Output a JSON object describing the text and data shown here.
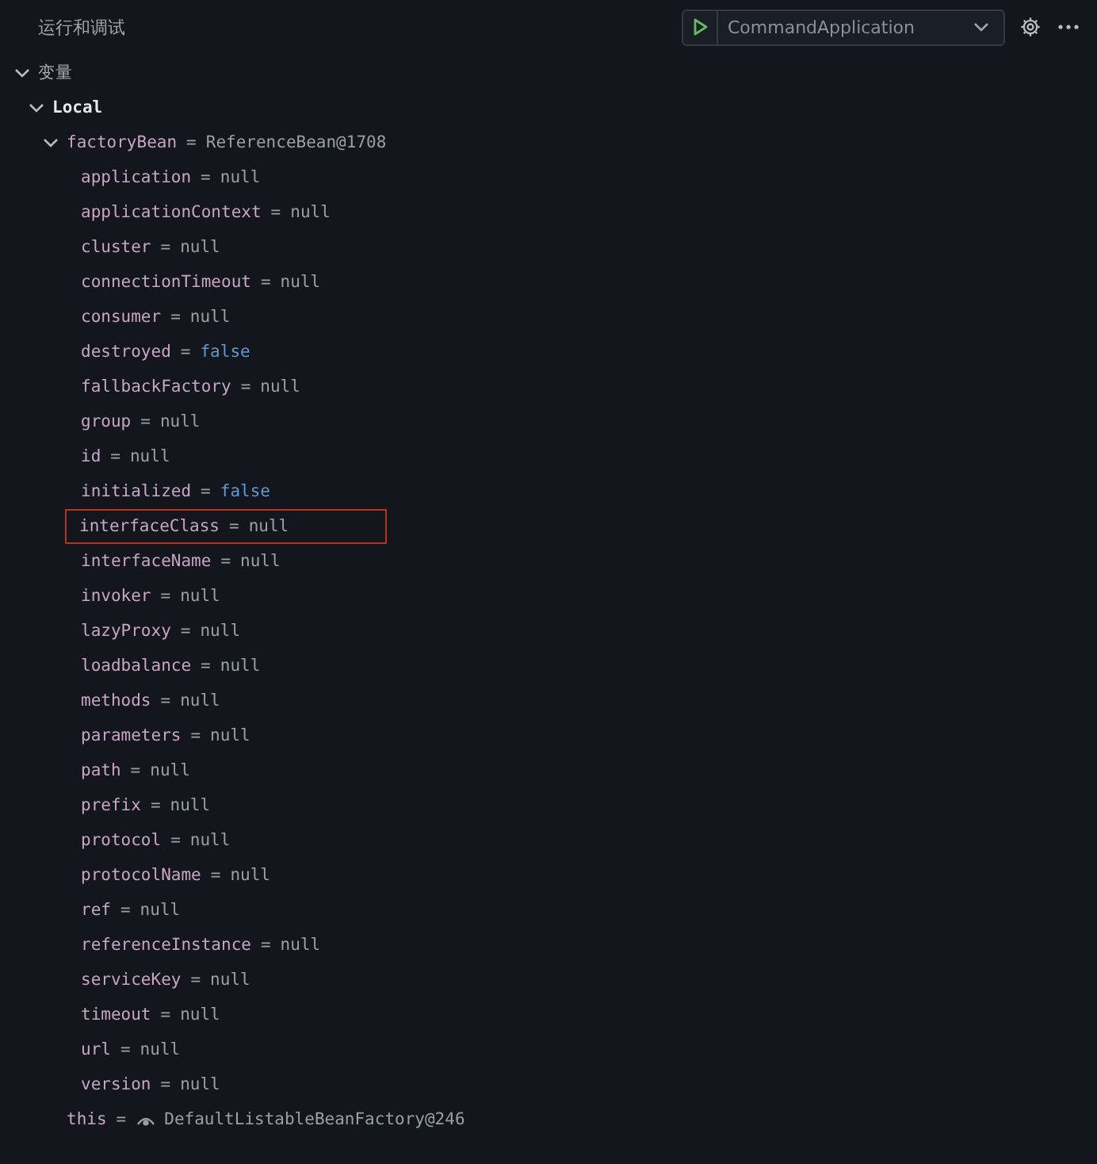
{
  "panel": {
    "title": "运行和调试"
  },
  "launch": {
    "config": "CommandApplication"
  },
  "tree": [
    {
      "name": "变量",
      "kind": "section",
      "expanded": true,
      "children": [
        {
          "name": "Local",
          "kind": "scope",
          "expanded": true,
          "children": [
            {
              "name": "factoryBean",
              "sep": "=",
              "value": "ReferenceBean@1708",
              "kind": "object",
              "expanded": true,
              "children": [
                {
                  "name": "application",
                  "sep": "=",
                  "value": "null",
                  "kind": "null"
                },
                {
                  "name": "applicationContext",
                  "sep": "=",
                  "value": "null",
                  "kind": "null"
                },
                {
                  "name": "cluster",
                  "sep": "=",
                  "value": "null",
                  "kind": "null"
                },
                {
                  "name": "connectionTimeout",
                  "sep": "=",
                  "value": "null",
                  "kind": "null"
                },
                {
                  "name": "consumer",
                  "sep": "=",
                  "value": "null",
                  "kind": "null"
                },
                {
                  "name": "destroyed",
                  "sep": "=",
                  "value": "false",
                  "kind": "boolean"
                },
                {
                  "name": "fallbackFactory",
                  "sep": "=",
                  "value": "null",
                  "kind": "null"
                },
                {
                  "name": "group",
                  "sep": "=",
                  "value": "null",
                  "kind": "null"
                },
                {
                  "name": "id",
                  "sep": "=",
                  "value": "null",
                  "kind": "null"
                },
                {
                  "name": "initialized",
                  "sep": "=",
                  "value": "false",
                  "kind": "boolean"
                },
                {
                  "name": "interfaceClass",
                  "sep": "=",
                  "value": "null",
                  "kind": "null",
                  "highlighted": true
                },
                {
                  "name": "interfaceName",
                  "sep": "=",
                  "value": "null",
                  "kind": "null"
                },
                {
                  "name": "invoker",
                  "sep": "=",
                  "value": "null",
                  "kind": "null"
                },
                {
                  "name": "lazyProxy",
                  "sep": "=",
                  "value": "null",
                  "kind": "null"
                },
                {
                  "name": "loadbalance",
                  "sep": "=",
                  "value": "null",
                  "kind": "null"
                },
                {
                  "name": "methods",
                  "sep": "=",
                  "value": "null",
                  "kind": "null"
                },
                {
                  "name": "parameters",
                  "sep": "=",
                  "value": "null",
                  "kind": "null"
                },
                {
                  "name": "path",
                  "sep": "=",
                  "value": "null",
                  "kind": "null"
                },
                {
                  "name": "prefix",
                  "sep": "=",
                  "value": "null",
                  "kind": "null"
                },
                {
                  "name": "protocol",
                  "sep": "=",
                  "value": "null",
                  "kind": "null"
                },
                {
                  "name": "protocolName",
                  "sep": "=",
                  "value": "null",
                  "kind": "null"
                },
                {
                  "name": "ref",
                  "sep": "=",
                  "value": "null",
                  "kind": "null"
                },
                {
                  "name": "referenceInstance",
                  "sep": "=",
                  "value": "null",
                  "kind": "null"
                },
                {
                  "name": "serviceKey",
                  "sep": "=",
                  "value": "null",
                  "kind": "null"
                },
                {
                  "name": "timeout",
                  "sep": "=",
                  "value": "null",
                  "kind": "null"
                },
                {
                  "name": "url",
                  "sep": "=",
                  "value": "null",
                  "kind": "null"
                },
                {
                  "name": "version",
                  "sep": "=",
                  "value": "null",
                  "kind": "null"
                }
              ]
            },
            {
              "name": "this",
              "sep": "=",
              "value": "DefaultListableBeanFactory@246",
              "kind": "lazy"
            }
          ]
        }
      ]
    }
  ]
}
